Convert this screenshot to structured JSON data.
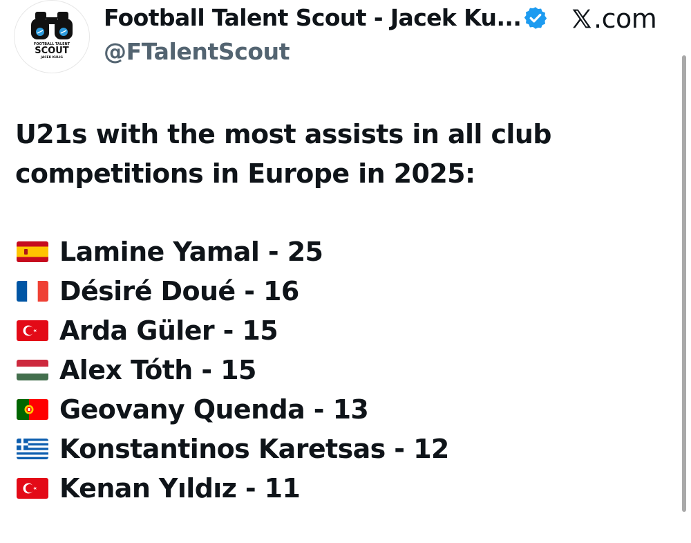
{
  "author": {
    "display_name": "Football Talent Scout - Jacek Ku...",
    "handle": "@FTalentScout",
    "avatar": {
      "icon": "binoculars-icon",
      "logo_line1": "FOOTBALL TALENT",
      "logo_line2": "SCOUT",
      "logo_line3": "JACEK KULIG"
    },
    "verified_icon": "verified-badge-icon",
    "verified_color": "#1d9bf0"
  },
  "source": {
    "icon": "x-logo-icon",
    "label": ".com"
  },
  "tweet": {
    "line1": "U21s with the most assists in all club",
    "line2": "competitions in Europe in 2025:"
  },
  "players": [
    {
      "flag": "spain-flag-icon",
      "text": "Lamine Yamal - 25"
    },
    {
      "flag": "france-flag-icon",
      "text": "Désiré Doué - 16"
    },
    {
      "flag": "turkey-flag-icon",
      "text": "Arda Güler - 15"
    },
    {
      "flag": "hungary-flag-icon",
      "text": "Alex Tóth - 15"
    },
    {
      "flag": "portugal-flag-icon",
      "text": "Geovany Quenda - 13"
    },
    {
      "flag": "greece-flag-icon",
      "text": "Konstantinos Karetsas - 12"
    },
    {
      "flag": "turkey-flag-icon",
      "text": "Kenan Yıldız - 11"
    }
  ]
}
